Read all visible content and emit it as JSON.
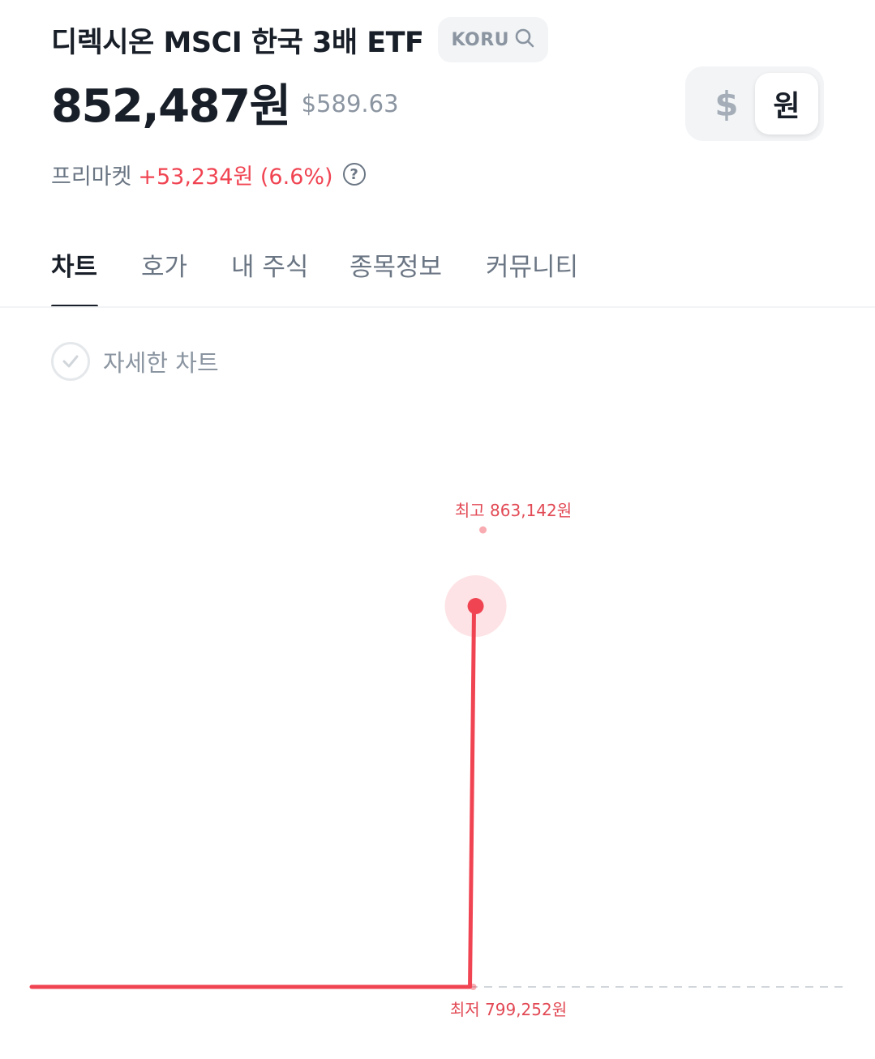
{
  "header": {
    "title": "디렉시온 MSCI 한국 3배 ETF",
    "ticker": "KORU",
    "price_krw": "852,487원",
    "price_usd": "$589.63"
  },
  "currency_toggle": {
    "dollar_label": "$",
    "won_label": "원",
    "selected": "원"
  },
  "premarket": {
    "label": "프리마켓",
    "change": "+53,234원 (6.6%)",
    "help_symbol": "?"
  },
  "tabs": [
    {
      "label": "차트",
      "active": true
    },
    {
      "label": "호가",
      "active": false
    },
    {
      "label": "내 주식",
      "active": false
    },
    {
      "label": "종목정보",
      "active": false
    },
    {
      "label": "커뮤니티",
      "active": false
    }
  ],
  "detail_chart_toggle": {
    "label": "자세한 차트",
    "checked": false
  },
  "colors": {
    "up_red": "#f04452",
    "text_primary": "#191f28",
    "text_secondary": "#6b7684",
    "text_tertiary": "#8b95a1",
    "chip_bg": "#f2f4f6"
  },
  "chart_data": {
    "type": "line",
    "title": "",
    "xlabel": "",
    "ylabel": "",
    "high_label": "최고 863,142원",
    "low_label": "최저 799,252원",
    "high": 863142,
    "low": 799252,
    "ylim": [
      799252,
      863142
    ],
    "series": [
      {
        "x": [
          0,
          0.54,
          0.545
        ],
        "y": [
          799252,
          799252,
          852487
        ]
      }
    ],
    "current_value": 852487,
    "high_x": 0.55,
    "low_x": 0.54,
    "reference_line": 799252
  }
}
